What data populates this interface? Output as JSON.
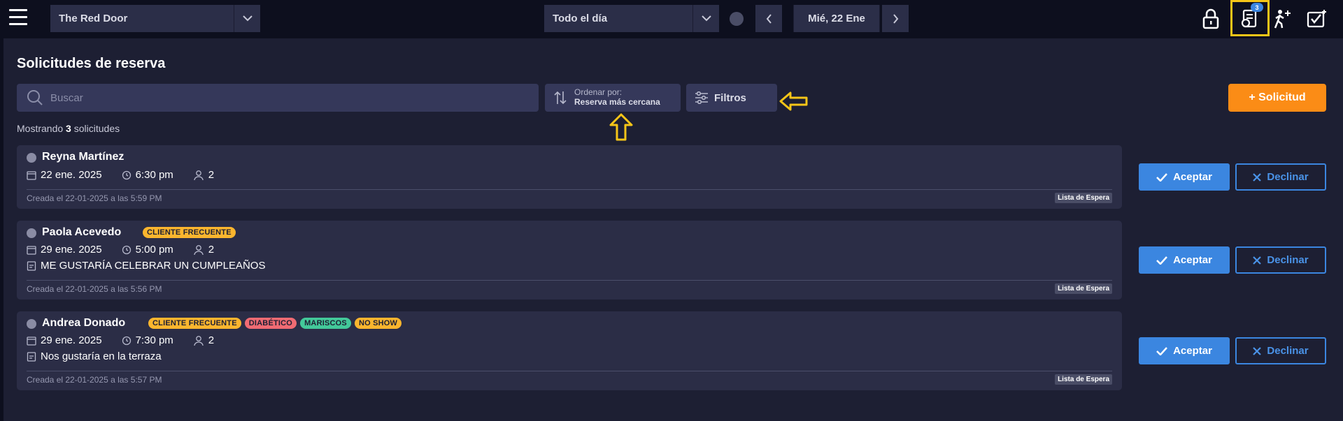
{
  "topbar": {
    "venue": "The Red Door",
    "time_filter": "Todo el día",
    "date": "Mié, 22 Ene",
    "requests_badge": "3"
  },
  "page": {
    "title": "Solicitudes de reserva",
    "search_placeholder": "Buscar",
    "sort_label": "Ordenar por:",
    "sort_value": "Reserva más cercana",
    "filters_label": "Filtros",
    "add_label": "+ Solicitud",
    "showing_prefix": "Mostrando",
    "showing_count": "3",
    "showing_suffix": "solicitudes"
  },
  "actions": {
    "accept": "Aceptar",
    "decline": "Declinar"
  },
  "requests": [
    {
      "name": "Reyna Martínez",
      "tags": [],
      "date": "22 ene. 2025",
      "time": "6:30 pm",
      "guests": "2",
      "note": "",
      "created": "Creada el 22-01-2025 a las 5:59 PM",
      "list": "Lista de Espera"
    },
    {
      "name": "Paola Acevedo",
      "tags": [
        {
          "text": "CLIENTE FRECUENTE",
          "color": "#fbb52e"
        }
      ],
      "date": "29 ene. 2025",
      "time": "5:00 pm",
      "guests": "2",
      "note": "ME GUSTARÍA CELEBRAR UN CUMPLEAÑOS",
      "created": "Creada el 22-01-2025 a las 5:56 PM",
      "list": "Lista de Espera"
    },
    {
      "name": "Andrea Donado",
      "tags": [
        {
          "text": "CLIENTE FRECUENTE",
          "color": "#fbb52e"
        },
        {
          "text": "DIABÉTICO",
          "color": "#f06b73"
        },
        {
          "text": "MARISCOS",
          "color": "#43c99a"
        },
        {
          "text": "NO SHOW",
          "color": "#fbb52e"
        }
      ],
      "date": "29 ene. 2025",
      "time": "7:30 pm",
      "guests": "2",
      "note": "Nos gustaría en la terraza",
      "created": "Creada el 22-01-2025 a las 5:57 PM",
      "list": "Lista de Espera"
    }
  ],
  "colors": {
    "accent": "#3b86e0",
    "primary_button": "#fb8c16",
    "highlight": "#f5c518"
  }
}
